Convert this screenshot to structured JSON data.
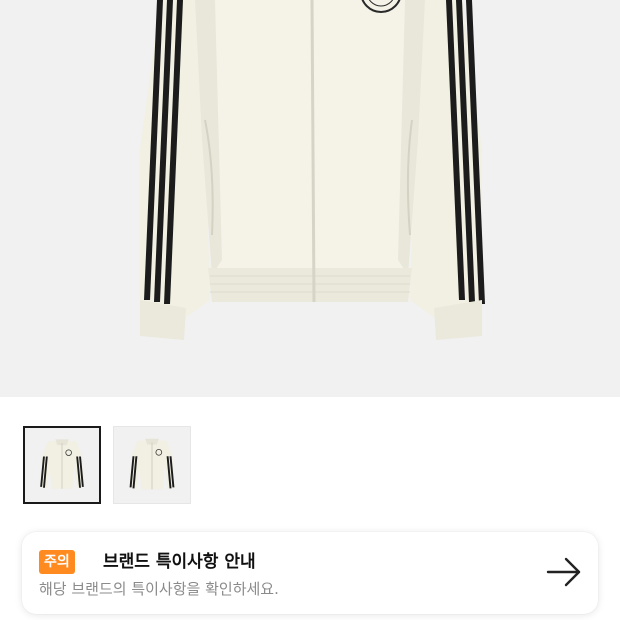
{
  "product": {
    "images": [
      {
        "name": "jacket-front-white",
        "icon": "jacket-image"
      },
      {
        "name": "jacket-front-alt",
        "icon": "jacket-image"
      }
    ],
    "selected_image_index": 0,
    "colors": {
      "jacket": "#f2f0e3",
      "stripes": "#1c1c1c",
      "background": "#f1f1f1"
    }
  },
  "notice": {
    "badge": "주의",
    "title": "브랜드 특이사항 안내",
    "subtitle": "해당 브랜드의 특이사항을 확인하세요.",
    "arrow_icon": "arrow-right-icon",
    "badge_color": "#ff8a1f"
  }
}
